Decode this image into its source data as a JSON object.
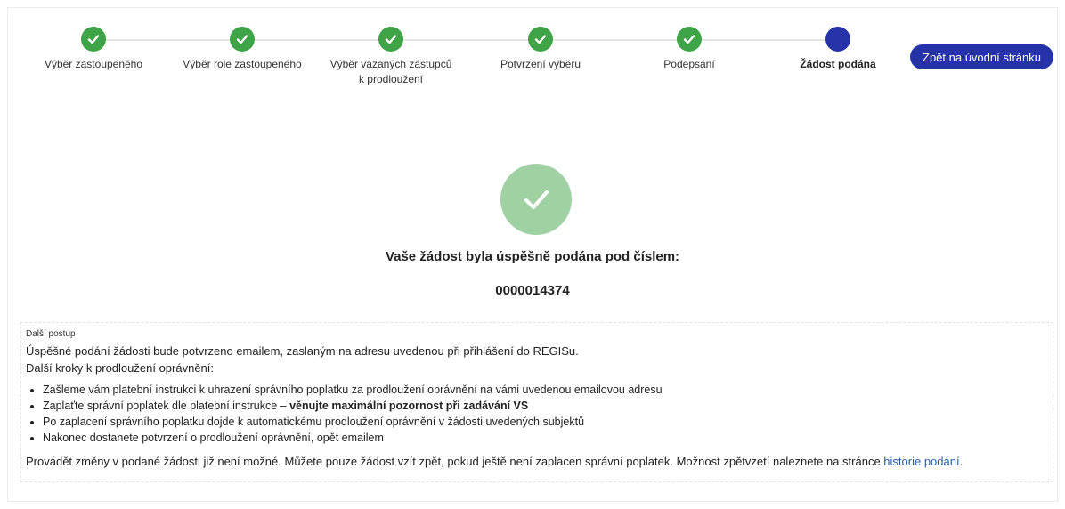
{
  "stepper": {
    "steps": [
      {
        "label": "Výběr zastoupeného",
        "state": "done"
      },
      {
        "label": "Výběr role zastoupeného",
        "state": "done"
      },
      {
        "label": "Výběr vázaných zástupců k prodloužení",
        "state": "done"
      },
      {
        "label": "Potvrzení výběru",
        "state": "done"
      },
      {
        "label": "Podepsání",
        "state": "done"
      },
      {
        "label": "Žádost podána",
        "state": "current"
      }
    ],
    "home_button": "Zpět na úvodní stránku"
  },
  "result": {
    "title": "Vaše žádost byla úspěšně podána pod číslem:",
    "number": "0000014374"
  },
  "info": {
    "heading": "Další postup",
    "line1": "Úspěšné podání žádosti bude potvrzeno emailem, zaslaným na adresu uvedenou při přihlášení do REGISu.",
    "line2": "Další kroky k prodloužení oprávnění:",
    "bullets": [
      "Zašleme vám platební instrukci k uhrazení správního poplatku za prodloužení oprávnění na vámi uvedenou emailovou adresu",
      "Zaplaťte správní poplatek dle platební instrukce – ",
      "Po zaplacení správního poplatku dojde k automatickému prodloužení oprávnění v žádosti uvedených subjektů",
      "Nakonec dostanete potvrzení o prodloužení oprávnění, opět emailem"
    ],
    "bullet2_bold": "věnujte maximální pozornost při zadávání VS",
    "footer": "Provádět změny v podané žádosti již není možné. Můžete pouze žádost vzít zpět, pokud ještě není zaplacen správní poplatek. Možnost zpětvzetí naleznete na stránce ",
    "footer_link": "historie podání",
    "footer_end": "."
  },
  "colors": {
    "done": "#3fa347",
    "current": "#2633a8",
    "success_circle": "#9fd1a3",
    "link": "#2a5fa8"
  },
  "icons": {
    "step_done": "check-icon",
    "success": "check-circle-icon"
  }
}
